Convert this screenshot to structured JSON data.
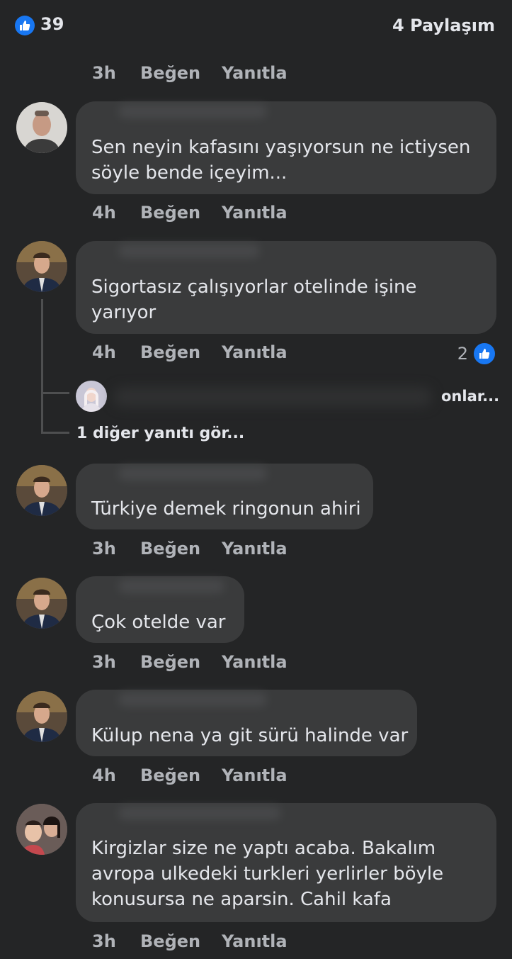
{
  "summary": {
    "like_count": "39",
    "shares": "4 Paylaşım"
  },
  "actions": {
    "like": "Beğen",
    "reply": "Yanıtla"
  },
  "top_meta": {
    "time": "3h"
  },
  "comments": [
    {
      "text": "Sen neyin kafasını yaşıyorsun ne ictiysen\nsöyle bende içeyim...",
      "time": "4h"
    },
    {
      "text": "Sigortasız çalışıyorlar otelinde işine\nyarıyor",
      "time": "4h",
      "reactions": "2"
    },
    {
      "text": "Türkiye demek ringonun ahiri",
      "time": "3h"
    },
    {
      "text": "Çok otelde var",
      "time": "3h"
    },
    {
      "text": "Külup nena ya git sürü halinde var",
      "time": "4h"
    },
    {
      "text": "Kirgizlar size ne yaptı acaba. Bakalım\navropa ulkedeki turkleri yerlirler böyle\nkonusursa ne aparsin. Cahil kafa",
      "time": "3h"
    }
  ],
  "reply_preview": {
    "time": "onlar..."
  },
  "more_replies": "1 diğer yanıtı gör...",
  "colors": {
    "background": "#242526",
    "bubble": "#3a3b3c",
    "accent": "#1877f2",
    "muted_text": "#b0b3b8"
  },
  "icons": {
    "like": "thumbs-up-icon"
  }
}
